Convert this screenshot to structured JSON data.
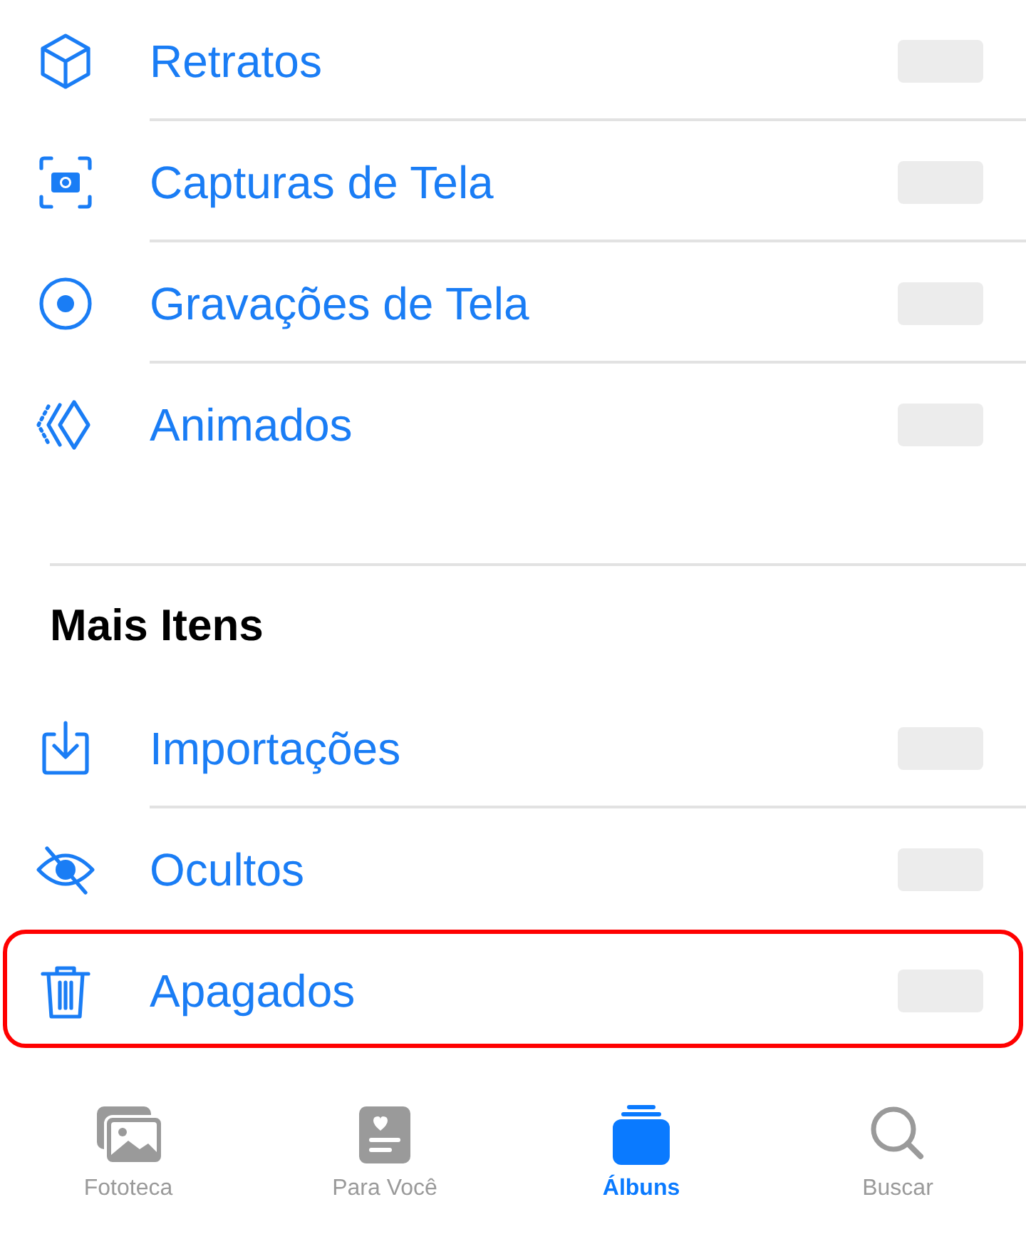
{
  "sections": [
    {
      "items": [
        {
          "kind": "cube",
          "label": "Retratos",
          "highlighted": false
        },
        {
          "kind": "screenshot",
          "label": "Capturas de Tela",
          "highlighted": false
        },
        {
          "kind": "record",
          "label": "Gravações de Tela",
          "highlighted": false
        },
        {
          "kind": "animated",
          "label": "Animados",
          "highlighted": false
        }
      ]
    },
    {
      "title": "Mais Itens",
      "items": [
        {
          "kind": "import",
          "label": "Importações",
          "highlighted": false
        },
        {
          "kind": "hidden",
          "label": "Ocultos",
          "highlighted": false
        },
        {
          "kind": "trash",
          "label": "Apagados",
          "highlighted": true
        }
      ]
    }
  ],
  "tab_bar": [
    {
      "kind": "library",
      "label": "Fototeca",
      "selected": false
    },
    {
      "kind": "foryou",
      "label": "Para Você",
      "selected": false
    },
    {
      "kind": "albums",
      "label": "Álbuns",
      "selected": true
    },
    {
      "kind": "search",
      "label": "Buscar",
      "selected": false
    }
  ]
}
